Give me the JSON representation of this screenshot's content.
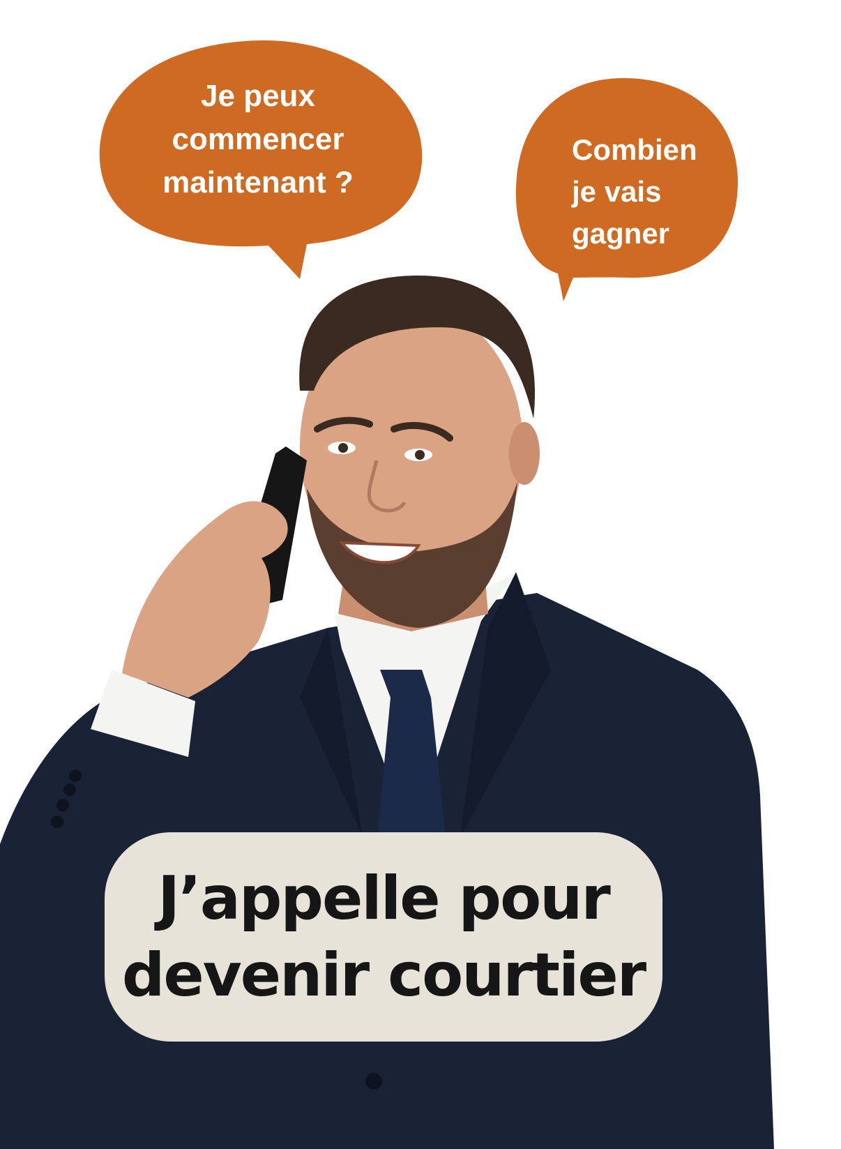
{
  "colors": {
    "bubble": "#cf6a22",
    "caption_bg": "#e8e3d8",
    "caption_text": "#161616",
    "suit": "#1a2236",
    "tie": "#1c2a4a",
    "shirt": "#f4f4f2",
    "skin": "#d9a384",
    "hair": "#3a2a20"
  },
  "bubbles": {
    "left": "Je peux\ncommencer\nmaintenant ?",
    "right": "Combien\nje vais\ngagner"
  },
  "caption": {
    "text": "J’appelle pour\ndevenir courtier"
  }
}
